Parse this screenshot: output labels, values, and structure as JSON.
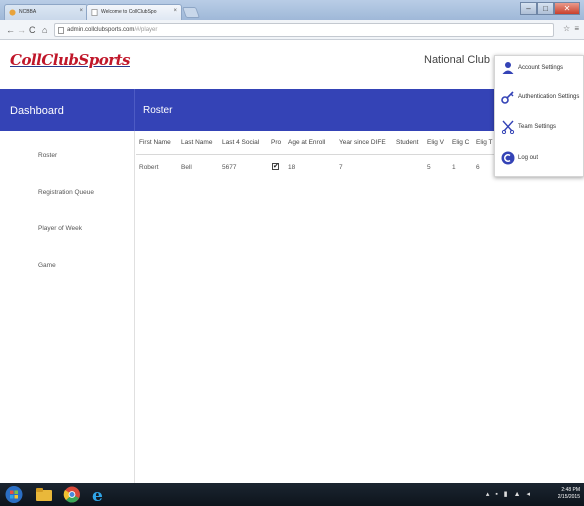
{
  "browser": {
    "tabs": [
      {
        "label": "NCBBA"
      },
      {
        "label": "Welcome to CollClubSpo"
      }
    ],
    "tab_close": "×",
    "url_host": "admin.collclubsports.com",
    "url_path": "/#/player",
    "window_buttons": {
      "minimize": "–",
      "maximize": "□",
      "close": "✕"
    },
    "right_controls": "☆ ≡"
  },
  "header": {
    "logo": "CollClubSports",
    "org_name": "National Club Bas"
  },
  "band": {
    "dashboard": "Dashboard",
    "page_title": "Roster"
  },
  "sidebar": {
    "items": [
      {
        "label": "Roster"
      },
      {
        "label": "Registration Queue"
      },
      {
        "label": "Player of Week"
      },
      {
        "label": "Game"
      }
    ]
  },
  "roster_table": {
    "columns": [
      "First Name",
      "Last Name",
      "Last 4 Social",
      "Pro",
      "Age at Enroll",
      "Year since DIFE",
      "Student",
      "Elig V",
      "Elig C",
      "Elig T"
    ],
    "rows": [
      {
        "first_name": "Robert",
        "last_name": "Bell",
        "last4": "5677",
        "pro": "✔",
        "age": "18",
        "years": "7",
        "student": "",
        "elig_v": "5",
        "elig_c": "1",
        "elig_t": "6"
      }
    ]
  },
  "account_menu": {
    "items": [
      {
        "label": "Account Settings",
        "icon": "user-icon"
      },
      {
        "label": "Authentication Settings",
        "icon": "key-icon"
      },
      {
        "label": "Team Settings",
        "icon": "scissors-icon"
      },
      {
        "label": "Log out",
        "icon": "logout-icon"
      }
    ]
  },
  "taskbar": {
    "time": "2:48 PM",
    "date": "2/15/2015"
  },
  "colors": {
    "band": "#3443b6",
    "logo_red": "#c0172a",
    "logo_blue": "#2a3b8c"
  }
}
